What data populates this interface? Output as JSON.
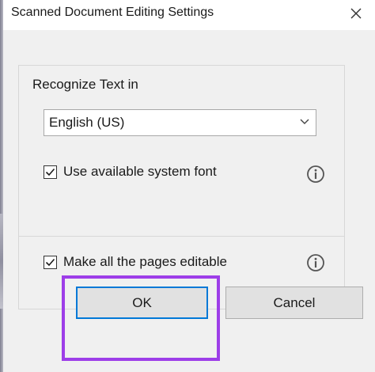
{
  "window": {
    "title": "Scanned Document Editing Settings",
    "close_icon": "close-icon"
  },
  "recognize_text": {
    "label": "Recognize Text in",
    "selected_language": "English (US)",
    "dropdown_icon": "chevron-down-icon"
  },
  "options": {
    "system_font": {
      "label": "Use available system font",
      "checked": true,
      "info_icon": "info-icon"
    },
    "all_pages_editable": {
      "label": "Make all the pages editable",
      "checked": true,
      "info_icon": "info-icon"
    }
  },
  "buttons": {
    "ok_label": "OK",
    "cancel_label": "Cancel"
  },
  "colors": {
    "highlight": "#9d3ee8",
    "focus_border": "#0078d7",
    "panel_background": "#f0f0f0",
    "button_background": "#e1e1e1"
  }
}
